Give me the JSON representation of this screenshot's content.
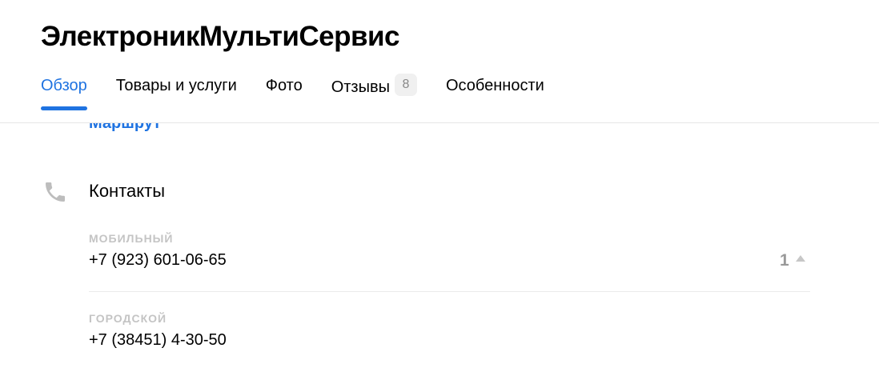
{
  "header": {
    "title": "ЭлектроникМультиСервис",
    "tabs": [
      {
        "label": "Обзор",
        "active": true
      },
      {
        "label": "Товары и услуги"
      },
      {
        "label": "Фото"
      },
      {
        "label": "Отзывы",
        "badge": "8"
      },
      {
        "label": "Особенности"
      }
    ]
  },
  "route": {
    "label": "Маршрут"
  },
  "contacts": {
    "title": "Контакты",
    "icon": "phone-icon",
    "phones": [
      {
        "label": "МОБИЛЬНЫЙ",
        "number": "+7 (923) 601-06-65",
        "votes": "1"
      },
      {
        "label": "ГОРОДСКОЙ",
        "number": "+7 (38451) 4-30-50"
      }
    ]
  },
  "colors": {
    "accent": "#1f73e1",
    "muted_label": "#c4c4c4",
    "icon_gray": "#bdbdbd"
  }
}
